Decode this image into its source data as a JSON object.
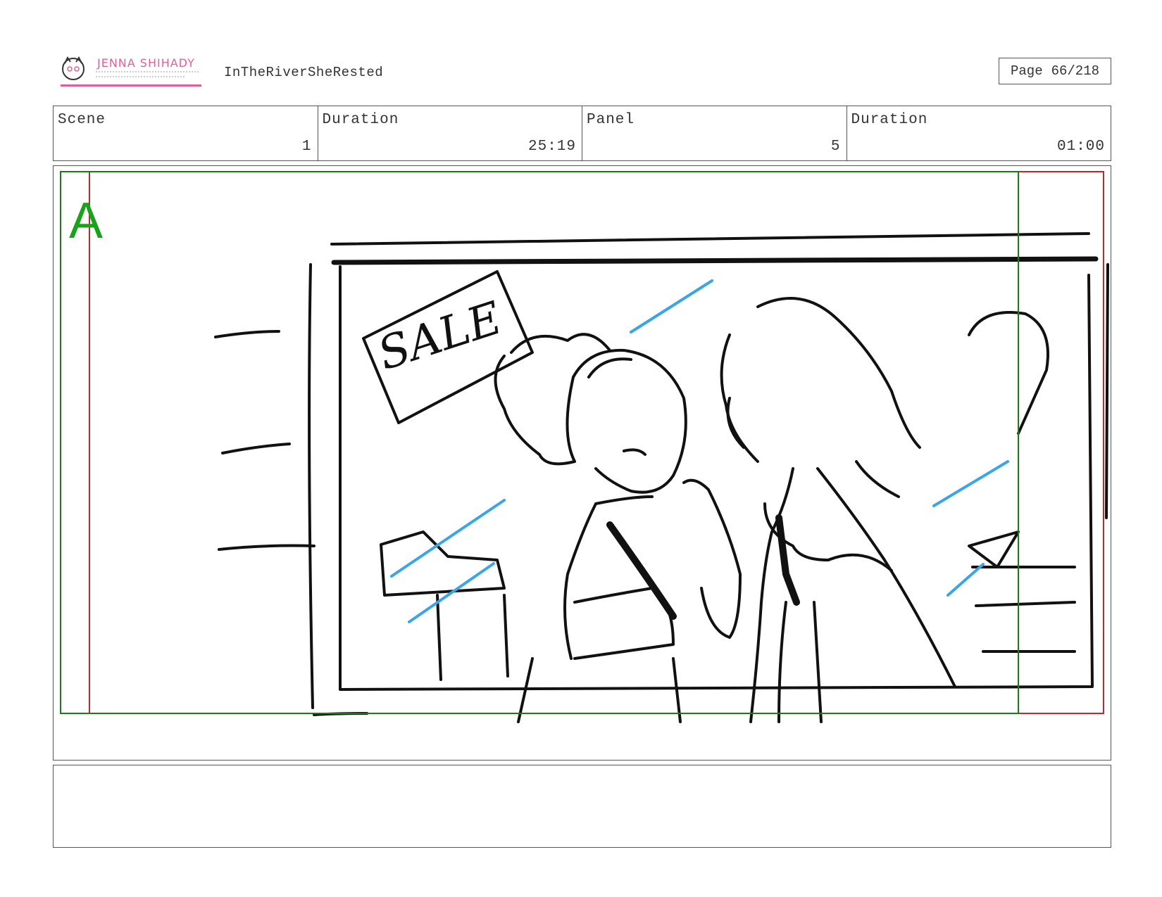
{
  "header": {
    "logo": {
      "name": "JENNA SHIHADY"
    },
    "project_title": "InTheRiverSheRested",
    "page": {
      "label": "Page",
      "value": "66/218"
    }
  },
  "info": {
    "scene_label": "Scene",
    "scene_value": "1",
    "scene_duration_label": "Duration",
    "scene_duration_value": "25:19",
    "panel_label": "Panel",
    "panel_value": "5",
    "panel_duration_label": "Duration",
    "panel_duration_value": "01:00"
  },
  "panel": {
    "letter": "A",
    "sketch_text": "SALE"
  },
  "notes": {
    "text": ""
  },
  "colors": {
    "safe_area": "#c0282d",
    "action_area": "#1a7a1a",
    "panel_letter": "#1aa31a",
    "glare": "#3aa5e8",
    "logo_pink": "#e0609a"
  }
}
